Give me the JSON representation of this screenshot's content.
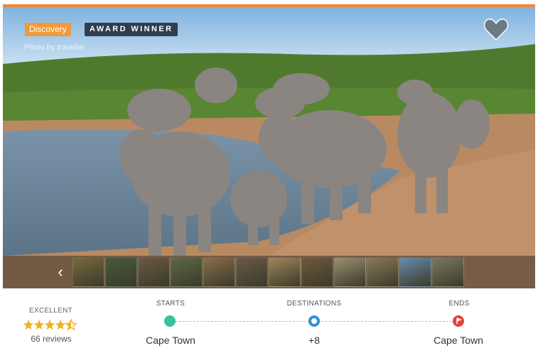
{
  "badges": {
    "discovery": "Discovery",
    "award": "AWARD WINNER"
  },
  "photo_credit": "Photo by traveller",
  "colors": {
    "accent": "#ef8a3c",
    "award_bg": "#2f3d4e",
    "start_pin": "#3bbf9e",
    "dest_pin": "#2f8fd6",
    "end_pin": "#e0433a",
    "star": "#f2b01e"
  },
  "icons": {
    "favorite": "heart-icon",
    "previous": "chevron-left-icon",
    "start": "map-pin-icon",
    "destinations": "circle-icon",
    "end": "flag-icon"
  },
  "rating": {
    "label": "EXCELLENT",
    "stars": 4.5,
    "reviews": "66 reviews"
  },
  "route": {
    "starts_label": "STARTS",
    "starts_value": "Cape Town",
    "destinations_label": "DESTINATIONS",
    "destinations_value": "+8",
    "ends_label": "ENDS",
    "ends_value": "Cape Town"
  },
  "gallery": {
    "thumbnail_count": 12,
    "thumbnails": [
      "#7a6a3e",
      "#4a5a3a",
      "#6b5a40",
      "#5d6a45",
      "#8a6e4a",
      "#6a5a48",
      "#a0865a",
      "#6f5a3a",
      "#9a9070",
      "#8a7a5a",
      "#6a8aaa",
      "#7a7a60"
    ]
  }
}
